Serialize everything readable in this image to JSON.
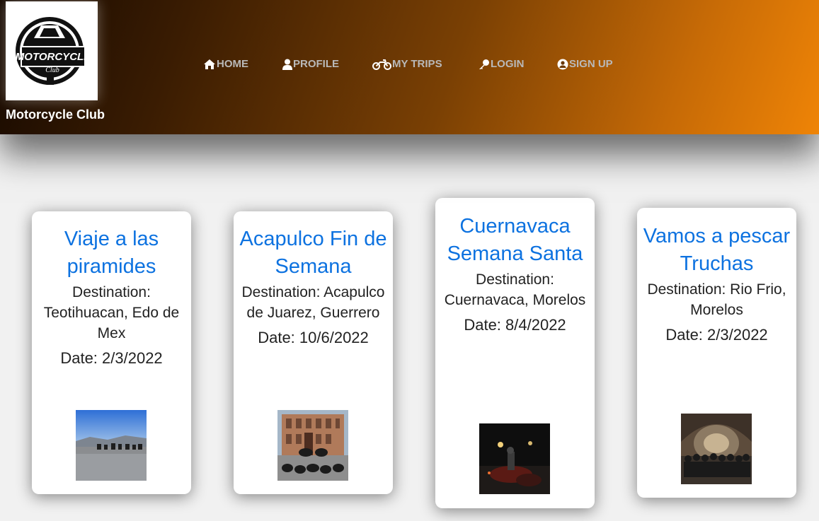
{
  "brand": {
    "logo_text_top": "MOTORCYCLE",
    "logo_text_bottom": "Club",
    "name": "Motorcycle Club"
  },
  "nav": [
    {
      "label": "HOME",
      "icon": "home-icon"
    },
    {
      "label": "PROFILE",
      "icon": "user-icon"
    },
    {
      "label": "MY TRIPS",
      "icon": "motorcycle-icon"
    },
    {
      "label": "LOGIN",
      "icon": "key-icon"
    },
    {
      "label": "SIGN UP",
      "icon": "user-circle-icon"
    }
  ],
  "trips": [
    {
      "title": "Viaje a las piramides",
      "destination": "Destination: Teotihuacan, Edo de Mex",
      "date": "Date: 2/3/2022"
    },
    {
      "title": "Acapulco Fin de Semana",
      "destination": "Destination: Acapulco de Juarez, Guerrero",
      "date": "Date: 10/6/2022"
    },
    {
      "title": "Cuernavaca Semana Santa",
      "destination": "Destination: Cuernavaca, Morelos",
      "date": "Date: 8/4/2022"
    },
    {
      "title": "Vamos a pescar Truchas",
      "destination": "Destination: Rio Frio, Morelos",
      "date": "Date: 2/3/2022"
    }
  ],
  "colors": {
    "header_dark": "#160900",
    "header_orange": "#ef8406",
    "title_blue": "#0d72e0",
    "nav_text": "#b9b9b9"
  }
}
